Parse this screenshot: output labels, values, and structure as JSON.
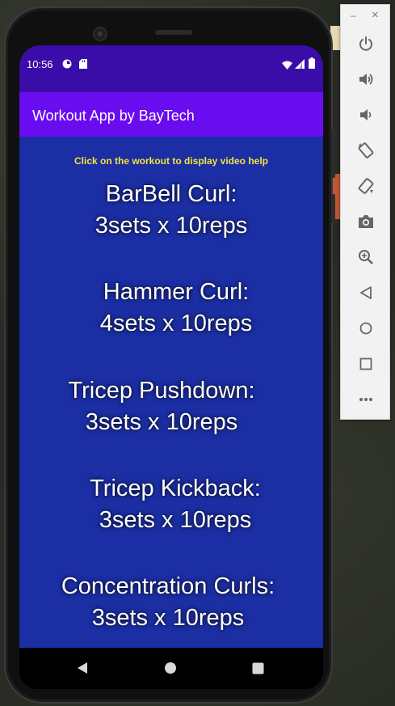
{
  "status_bar": {
    "time": "10:56",
    "icons": [
      "data-saver-icon",
      "sd-card-icon",
      "wifi-icon",
      "signal-icon",
      "battery-icon"
    ]
  },
  "app_bar": {
    "title": "Workout App by BayTech"
  },
  "content": {
    "hint": "Click on the workout to display video help",
    "workouts": [
      {
        "name": "BarBell Curl:",
        "detail": "3sets x 10reps"
      },
      {
        "name": "Hammer Curl:",
        "detail": "4sets x 10reps"
      },
      {
        "name": "Tricep Pushdown:",
        "detail": "3sets x 10reps"
      },
      {
        "name": "Tricep Kickback:",
        "detail": "3sets x 10reps"
      },
      {
        "name": "Concentration Curls:",
        "detail": "3sets x 10reps"
      }
    ]
  },
  "nav_bar": {
    "buttons": [
      "back-icon",
      "home-icon",
      "recents-icon"
    ]
  },
  "emulator_toolbar": {
    "minimize_label": "–",
    "close_label": "×",
    "buttons": [
      "power-icon",
      "volume-up-icon",
      "volume-down-icon",
      "rotate-left-icon",
      "rotate-right-icon",
      "screenshot-icon",
      "zoom-icon",
      "back-icon",
      "home-icon",
      "overview-icon",
      "more-icon"
    ]
  },
  "colors": {
    "status_bar": "#3a0ca8",
    "app_bar": "#6a0cf0",
    "content_bg": "#1b2ea3",
    "hint_text": "#f5e23a",
    "workout_text": "#ffffff"
  }
}
